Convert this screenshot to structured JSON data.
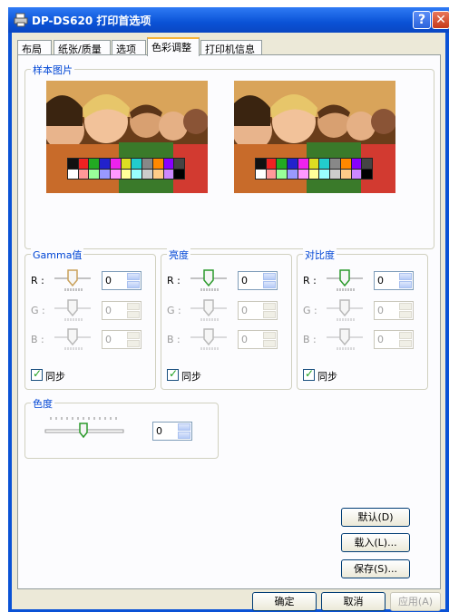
{
  "window": {
    "title": "DP-DS620 打印首选项",
    "help_label": "?",
    "close_label": "✕"
  },
  "tabs": [
    {
      "label": "布局"
    },
    {
      "label": "纸张/质量"
    },
    {
      "label": "选项"
    },
    {
      "label": "色彩调整"
    },
    {
      "label": "打印机信息"
    }
  ],
  "active_tab": "色彩调整",
  "sample": {
    "label": "样本图片"
  },
  "groups": {
    "gamma": {
      "label": "Gamma值",
      "rows": [
        {
          "channel": "R :",
          "value": "0",
          "enabled": true
        },
        {
          "channel": "G :",
          "value": "0",
          "enabled": false
        },
        {
          "channel": "B :",
          "value": "0",
          "enabled": false
        }
      ],
      "sync_label": "同步",
      "sync_checked": true
    },
    "brightness": {
      "label": "亮度",
      "rows": [
        {
          "channel": "R :",
          "value": "0",
          "enabled": true
        },
        {
          "channel": "G :",
          "value": "0",
          "enabled": false
        },
        {
          "channel": "B :",
          "value": "0",
          "enabled": false
        }
      ],
      "sync_label": "同步",
      "sync_checked": true
    },
    "contrast": {
      "label": "对比度",
      "rows": [
        {
          "channel": "R :",
          "value": "0",
          "enabled": true
        },
        {
          "channel": "G :",
          "value": "0",
          "enabled": false
        },
        {
          "channel": "B :",
          "value": "0",
          "enabled": false
        }
      ],
      "sync_label": "同步",
      "sync_checked": true
    },
    "chroma": {
      "label": "色度",
      "value": "0"
    }
  },
  "side_buttons": {
    "default_label": "默认(D)",
    "load_label": "载入(L)...",
    "save_label": "保存(S)..."
  },
  "footer": {
    "ok_label": "确定",
    "cancel_label": "取消",
    "apply_label": "应用(A)"
  },
  "colors": {
    "title_bar": "#0a52d6",
    "dialog_bg": "#ece9d8",
    "group_label": "#0046d5"
  }
}
